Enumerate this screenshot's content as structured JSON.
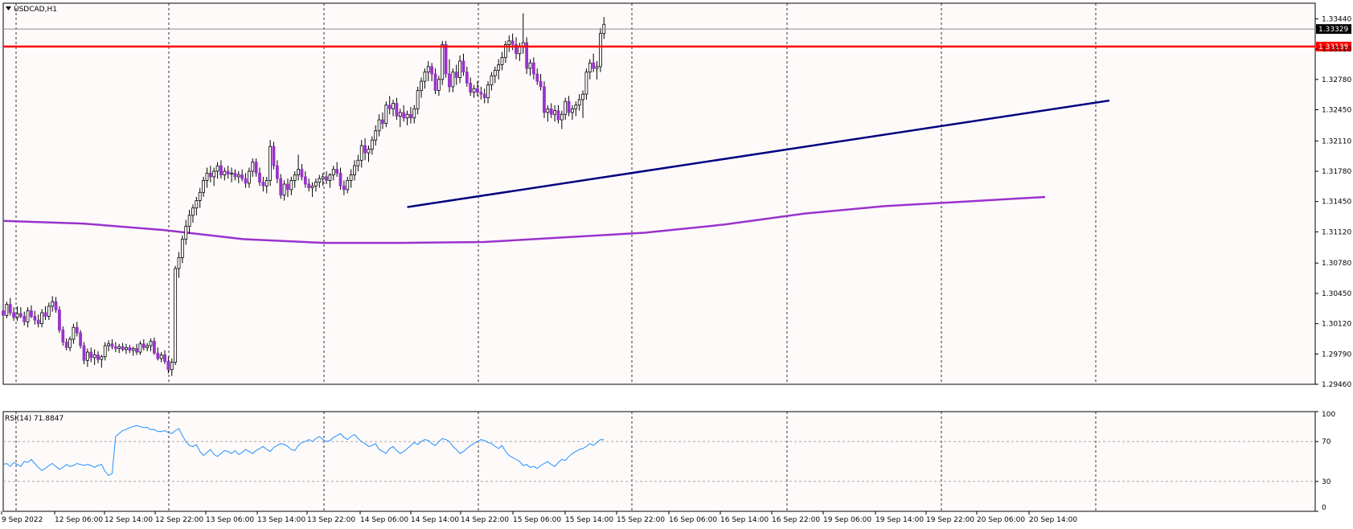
{
  "chart_data": [
    {
      "type": "candlestick",
      "symbol_label": "USDCAD,H1",
      "ylim": [
        1.2946,
        1.3361
      ],
      "y_ticks": [
        "1.33440",
        "1.33110",
        "1.32780",
        "1.32450",
        "1.32110",
        "1.31780",
        "1.31450",
        "1.31120",
        "1.30780",
        "1.30450",
        "1.30120",
        "1.29790",
        "1.29460"
      ],
      "x_ticks": [
        "9 Sep 2022",
        "12 Sep 06:00",
        "12 Sep 14:00",
        "12 Sep 22:00",
        "13 Sep 06:00",
        "13 Sep 14:00",
        "13 Sep 22:00",
        "14 Sep 06:00",
        "14 Sep 14:00",
        "14 Sep 22:00",
        "15 Sep 06:00",
        "15 Sep 14:00",
        "15 Sep 22:00",
        "16 Sep 06:00",
        "16 Sep 14:00",
        "16 Sep 22:00",
        "19 Sep 06:00",
        "19 Sep 14:00",
        "19 Sep 22:00",
        "20 Sep 06:00",
        "20 Sep 14:00"
      ],
      "current_price_label": "1.33329",
      "current_price": 1.33329,
      "resistance_label": "1.33138",
      "resistance_price": 1.33138,
      "ma_values": [
        1.3124,
        1.3121,
        1.3114,
        1.3104,
        1.31,
        1.31,
        1.3101,
        1.3106,
        1.3111,
        1.312,
        1.3132,
        1.314,
        1.3145,
        1.315
      ],
      "trendline": {
        "start_index": 115,
        "start_price": 1.3139,
        "end_index": 309,
        "end_price": 1.3255
      },
      "colors": {
        "bull_body": "#ffffff",
        "bull_outline": "#000000",
        "bear_body": "#9933cc",
        "resistance": "#ff0000",
        "trendline": "#000080",
        "ma": "#9933cc",
        "rsi": "#1e90ff",
        "current_price_bg": "#000000",
        "resistance_bg": "#ff0000"
      },
      "candles_ohlc": [
        [
          1.3026,
          1.3036,
          1.3019,
          1.3021
        ],
        [
          1.3021,
          1.3036,
          1.3018,
          1.3033
        ],
        [
          1.3033,
          1.304,
          1.3021,
          1.3024
        ],
        [
          1.3024,
          1.303,
          1.3015,
          1.3019
        ],
        [
          1.3019,
          1.3031,
          1.3015,
          1.3023
        ],
        [
          1.3023,
          1.303,
          1.3018,
          1.302
        ],
        [
          1.302,
          1.3025,
          1.301,
          1.3014
        ],
        [
          1.3014,
          1.303,
          1.3008,
          1.3026
        ],
        [
          1.3026,
          1.3032,
          1.3018,
          1.302
        ],
        [
          1.302,
          1.3026,
          1.3011,
          1.3016
        ],
        [
          1.3016,
          1.3022,
          1.3008,
          1.3012
        ],
        [
          1.3012,
          1.3028,
          1.3008,
          1.3024
        ],
        [
          1.3024,
          1.3031,
          1.3016,
          1.302
        ],
        [
          1.302,
          1.3035,
          1.3016,
          1.3031
        ],
        [
          1.3031,
          1.3042,
          1.3025,
          1.3036
        ],
        [
          1.3036,
          1.3041,
          1.3024,
          1.3027
        ],
        [
          1.3027,
          1.3031,
          1.3002,
          1.3005
        ],
        [
          1.3005,
          1.3009,
          1.2988,
          1.2992
        ],
        [
          1.2992,
          1.2996,
          1.2983,
          1.2986
        ],
        [
          1.2986,
          1.2998,
          1.2982,
          1.2995
        ],
        [
          1.2995,
          1.3012,
          1.299,
          1.3008
        ],
        [
          1.3008,
          1.3014,
          1.2998,
          1.3002
        ],
        [
          1.3002,
          1.3005,
          1.2985,
          1.2988
        ],
        [
          1.2988,
          1.2992,
          1.2968,
          1.2972
        ],
        [
          1.2972,
          1.2985,
          1.2965,
          1.2981
        ],
        [
          1.2981,
          1.2986,
          1.297,
          1.2975
        ],
        [
          1.2975,
          1.2984,
          1.2967,
          1.2978
        ],
        [
          1.2978,
          1.2982,
          1.2969,
          1.2973
        ],
        [
          1.2973,
          1.2978,
          1.2964,
          1.2976
        ],
        [
          1.2976,
          1.2992,
          1.2972,
          1.2988
        ],
        [
          1.2988,
          1.2994,
          1.2982,
          1.299
        ],
        [
          1.299,
          1.2995,
          1.2984,
          1.2987
        ],
        [
          1.2987,
          1.2992,
          1.2981,
          1.2985
        ],
        [
          1.2985,
          1.299,
          1.298,
          1.2987
        ],
        [
          1.2987,
          1.2991,
          1.2982,
          1.2984
        ],
        [
          1.2984,
          1.299,
          1.2979,
          1.2986
        ],
        [
          1.2986,
          1.2989,
          1.298,
          1.2983
        ],
        [
          1.2983,
          1.2987,
          1.2977,
          1.2985
        ],
        [
          1.2985,
          1.299,
          1.2978,
          1.2981
        ],
        [
          1.2981,
          1.2993,
          1.2978,
          1.299
        ],
        [
          1.299,
          1.2995,
          1.2983,
          1.2986
        ],
        [
          1.2986,
          1.2991,
          1.2982,
          1.2988
        ],
        [
          1.2988,
          1.2996,
          1.2982,
          1.2993
        ],
        [
          1.2993,
          1.2997,
          1.2978,
          1.298
        ],
        [
          1.298,
          1.2986,
          1.2972,
          1.2974
        ],
        [
          1.2974,
          1.2981,
          1.297,
          1.2978
        ],
        [
          1.2978,
          1.2983,
          1.2968,
          1.2971
        ],
        [
          1.2971,
          1.2976,
          1.2958,
          1.2962
        ],
        [
          1.2962,
          1.2974,
          1.2955,
          1.297
        ],
        [
          1.297,
          1.3075,
          1.2967,
          1.3072
        ],
        [
          1.3072,
          1.309,
          1.3062,
          1.3084
        ],
        [
          1.3084,
          1.3108,
          1.3078,
          1.3104
        ],
        [
          1.3104,
          1.3125,
          1.3098,
          1.3118
        ],
        [
          1.3118,
          1.3136,
          1.311,
          1.313
        ],
        [
          1.313,
          1.3142,
          1.3122,
          1.3138
        ],
        [
          1.3138,
          1.315,
          1.313,
          1.3146
        ],
        [
          1.3146,
          1.316,
          1.3138,
          1.3155
        ],
        [
          1.3155,
          1.3172,
          1.315,
          1.3168
        ],
        [
          1.3168,
          1.3182,
          1.316,
          1.3176
        ],
        [
          1.3176,
          1.3184,
          1.3166,
          1.3172
        ],
        [
          1.3172,
          1.3182,
          1.3162,
          1.3178
        ],
        [
          1.3178,
          1.3188,
          1.317,
          1.3184
        ],
        [
          1.3184,
          1.319,
          1.317,
          1.3174
        ],
        [
          1.3174,
          1.3182,
          1.3168,
          1.3178
        ],
        [
          1.3178,
          1.3184,
          1.317,
          1.3175
        ],
        [
          1.3175,
          1.3182,
          1.3166,
          1.3176
        ],
        [
          1.3176,
          1.318,
          1.3168,
          1.3172
        ],
        [
          1.3172,
          1.3178,
          1.3165,
          1.3174
        ],
        [
          1.3174,
          1.318,
          1.3167,
          1.317
        ],
        [
          1.317,
          1.3176,
          1.316,
          1.3165
        ],
        [
          1.3165,
          1.3182,
          1.316,
          1.3178
        ],
        [
          1.3178,
          1.3192,
          1.3172,
          1.3188
        ],
        [
          1.3188,
          1.3192,
          1.3172,
          1.3176
        ],
        [
          1.3176,
          1.3182,
          1.3162,
          1.3166
        ],
        [
          1.3166,
          1.3172,
          1.3156,
          1.3162
        ],
        [
          1.3162,
          1.3172,
          1.3154,
          1.3168
        ],
        [
          1.3168,
          1.3212,
          1.3162,
          1.3205
        ],
        [
          1.3205,
          1.321,
          1.318,
          1.3184
        ],
        [
          1.3184,
          1.319,
          1.3165,
          1.317
        ],
        [
          1.317,
          1.3175,
          1.3148,
          1.3152
        ],
        [
          1.3152,
          1.3168,
          1.3146,
          1.3164
        ],
        [
          1.3164,
          1.317,
          1.315,
          1.3158
        ],
        [
          1.3158,
          1.3172,
          1.3152,
          1.3168
        ],
        [
          1.3168,
          1.3178,
          1.316,
          1.3174
        ],
        [
          1.3174,
          1.3196,
          1.3168,
          1.318
        ],
        [
          1.318,
          1.3186,
          1.3168,
          1.3172
        ],
        [
          1.3172,
          1.3178,
          1.316,
          1.3164
        ],
        [
          1.3164,
          1.317,
          1.3156,
          1.316
        ],
        [
          1.316,
          1.3166,
          1.315,
          1.3162
        ],
        [
          1.3162,
          1.317,
          1.3156,
          1.3166
        ],
        [
          1.3166,
          1.3174,
          1.316,
          1.317
        ],
        [
          1.317,
          1.3176,
          1.3162,
          1.3172
        ],
        [
          1.3172,
          1.3178,
          1.3164,
          1.3168
        ],
        [
          1.3168,
          1.3176,
          1.316,
          1.3174
        ],
        [
          1.3174,
          1.3184,
          1.3168,
          1.318
        ],
        [
          1.318,
          1.3188,
          1.3172,
          1.3176
        ],
        [
          1.3176,
          1.3182,
          1.3158,
          1.3162
        ],
        [
          1.3162,
          1.3168,
          1.3152,
          1.3158
        ],
        [
          1.3158,
          1.3172,
          1.3154,
          1.3168
        ],
        [
          1.3168,
          1.318,
          1.316,
          1.3174
        ],
        [
          1.3174,
          1.319,
          1.3168,
          1.3184
        ],
        [
          1.3184,
          1.3196,
          1.3178,
          1.319
        ],
        [
          1.319,
          1.3212,
          1.3182,
          1.3206
        ],
        [
          1.3206,
          1.3214,
          1.319,
          1.3198
        ],
        [
          1.3198,
          1.3206,
          1.3188,
          1.3202
        ],
        [
          1.3202,
          1.3216,
          1.3196,
          1.3212
        ],
        [
          1.3212,
          1.3228,
          1.3206,
          1.3222
        ],
        [
          1.3222,
          1.324,
          1.3216,
          1.3234
        ],
        [
          1.3234,
          1.3242,
          1.3224,
          1.323
        ],
        [
          1.323,
          1.3254,
          1.3226,
          1.325
        ],
        [
          1.325,
          1.326,
          1.324,
          1.3246
        ],
        [
          1.3246,
          1.3256,
          1.3238,
          1.3252
        ],
        [
          1.3252,
          1.3258,
          1.3234,
          1.3238
        ],
        [
          1.3238,
          1.3246,
          1.3226,
          1.3242
        ],
        [
          1.3242,
          1.325,
          1.3232,
          1.3236
        ],
        [
          1.3236,
          1.3244,
          1.3228,
          1.324
        ],
        [
          1.324,
          1.3248,
          1.323,
          1.3236
        ],
        [
          1.3236,
          1.325,
          1.323,
          1.3246
        ],
        [
          1.3246,
          1.327,
          1.324,
          1.3266
        ],
        [
          1.3266,
          1.328,
          1.3258,
          1.3276
        ],
        [
          1.3276,
          1.329,
          1.3268,
          1.3286
        ],
        [
          1.3286,
          1.3298,
          1.3276,
          1.3292
        ],
        [
          1.3292,
          1.3296,
          1.3276,
          1.3284
        ],
        [
          1.3284,
          1.329,
          1.3262,
          1.3266
        ],
        [
          1.3266,
          1.3282,
          1.326,
          1.3278
        ],
        [
          1.3278,
          1.332,
          1.3272,
          1.3316
        ],
        [
          1.3316,
          1.332,
          1.328,
          1.3284
        ],
        [
          1.3284,
          1.33,
          1.3264,
          1.327
        ],
        [
          1.327,
          1.329,
          1.3264,
          1.3286
        ],
        [
          1.3286,
          1.3294,
          1.3272,
          1.328
        ],
        [
          1.328,
          1.3304,
          1.3274,
          1.3298
        ],
        [
          1.3298,
          1.3306,
          1.3282,
          1.3286
        ],
        [
          1.3286,
          1.3292,
          1.327,
          1.3274
        ],
        [
          1.3274,
          1.328,
          1.326,
          1.3264
        ],
        [
          1.3264,
          1.3272,
          1.3258,
          1.3268
        ],
        [
          1.3268,
          1.3276,
          1.326,
          1.3264
        ],
        [
          1.3264,
          1.327,
          1.3256,
          1.3262
        ],
        [
          1.3262,
          1.3268,
          1.3252,
          1.3258
        ],
        [
          1.3258,
          1.3276,
          1.3252,
          1.3272
        ],
        [
          1.3272,
          1.3286,
          1.3266,
          1.3282
        ],
        [
          1.3282,
          1.3292,
          1.3274,
          1.3288
        ],
        [
          1.3288,
          1.33,
          1.3278,
          1.3294
        ],
        [
          1.3294,
          1.3308,
          1.3288,
          1.3302
        ],
        [
          1.3302,
          1.332,
          1.3296,
          1.3316
        ],
        [
          1.3316,
          1.3326,
          1.3308,
          1.332
        ],
        [
          1.332,
          1.3328,
          1.331,
          1.3316
        ],
        [
          1.3316,
          1.3324,
          1.33,
          1.3306
        ],
        [
          1.3306,
          1.3318,
          1.3298,
          1.3314
        ],
        [
          1.3314,
          1.335,
          1.3306,
          1.3318
        ],
        [
          1.3318,
          1.3324,
          1.3284,
          1.329
        ],
        [
          1.329,
          1.33,
          1.3282,
          1.3296
        ],
        [
          1.3296,
          1.3302,
          1.3278,
          1.3284
        ],
        [
          1.3284,
          1.329,
          1.3272,
          1.3276
        ],
        [
          1.3276,
          1.3284,
          1.3266,
          1.327
        ],
        [
          1.327,
          1.3276,
          1.3236,
          1.3242
        ],
        [
          1.3242,
          1.325,
          1.3232,
          1.3246
        ],
        [
          1.3246,
          1.3252,
          1.3236,
          1.324
        ],
        [
          1.324,
          1.325,
          1.3232,
          1.3244
        ],
        [
          1.3244,
          1.325,
          1.323,
          1.3234
        ],
        [
          1.3234,
          1.3244,
          1.3224,
          1.324
        ],
        [
          1.324,
          1.3258,
          1.3234,
          1.3254
        ],
        [
          1.3254,
          1.326,
          1.3238,
          1.3242
        ],
        [
          1.3242,
          1.325,
          1.3234,
          1.3246
        ],
        [
          1.3246,
          1.3254,
          1.3238,
          1.325
        ],
        [
          1.325,
          1.3262,
          1.3244,
          1.3256
        ],
        [
          1.3256,
          1.3266,
          1.3236,
          1.3262
        ],
        [
          1.3262,
          1.329,
          1.3256,
          1.3286
        ],
        [
          1.3286,
          1.33,
          1.3278,
          1.3296
        ],
        [
          1.3296,
          1.3306,
          1.3286,
          1.329
        ],
        [
          1.329,
          1.3298,
          1.3278,
          1.3292
        ],
        [
          1.3292,
          1.3334,
          1.3286,
          1.3328
        ],
        [
          1.3328,
          1.3346,
          1.3322,
          1.3338
        ]
      ],
      "candle_x_step": 4.37
    },
    {
      "type": "line",
      "indicator_label": "RSI(14) 71.8847",
      "ylim": [
        0,
        100
      ],
      "y_ticks": [
        "100",
        "70",
        "30",
        "0"
      ],
      "levels": [
        70,
        30
      ],
      "values": [
        47,
        48,
        45,
        49,
        47,
        45,
        50,
        49,
        52,
        48,
        44,
        41,
        43,
        46,
        48,
        45,
        42,
        44,
        47,
        45,
        46,
        48,
        47,
        46,
        47,
        46,
        44,
        46,
        47,
        40,
        36,
        38,
        75,
        78,
        81,
        82,
        84,
        85,
        86,
        85,
        84,
        84,
        82,
        82,
        80,
        80,
        81,
        79,
        78,
        81,
        83,
        76,
        70,
        66,
        65,
        67,
        60,
        56,
        59,
        62,
        57,
        55,
        58,
        61,
        60,
        58,
        61,
        57,
        59,
        62,
        60,
        58,
        61,
        63,
        65,
        62,
        60,
        64,
        66,
        68,
        67,
        65,
        62,
        61,
        66,
        69,
        70,
        72,
        70,
        73,
        75,
        72,
        70,
        71,
        74,
        76,
        78,
        74,
        72,
        75,
        77,
        73,
        70,
        68,
        65,
        66,
        68,
        62,
        60,
        58,
        63,
        65,
        61,
        58,
        60,
        63,
        66,
        69,
        67,
        70,
        72,
        71,
        68,
        66,
        70,
        73,
        72,
        70,
        65,
        62,
        58,
        60,
        63,
        66,
        68,
        70,
        72,
        71,
        69,
        68,
        65,
        63,
        66,
        60,
        56,
        54,
        52,
        50,
        46,
        47,
        44,
        45,
        43,
        46,
        48,
        50,
        47,
        45,
        49,
        52,
        51,
        55,
        58,
        60,
        62,
        63,
        65,
        68,
        66,
        69,
        72,
        71.8847
      ]
    }
  ]
}
